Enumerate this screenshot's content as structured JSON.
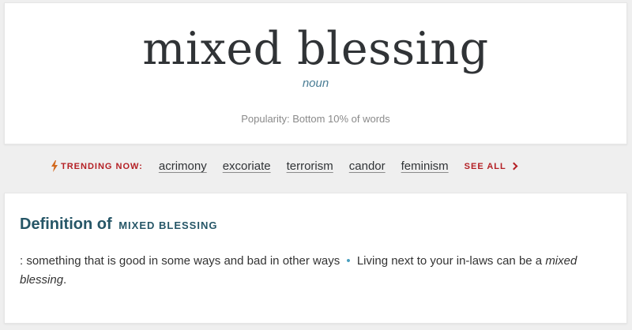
{
  "entry": {
    "headword": "mixed blessing",
    "part_of_speech": "noun",
    "popularity": "Popularity: Bottom 10% of words"
  },
  "trending": {
    "label": "TRENDING NOW:",
    "items": [
      "acrimony",
      "excoriate",
      "terrorism",
      "candor",
      "feminism"
    ],
    "see_all": "SEE ALL",
    "icon": "lightning-bolt-icon"
  },
  "definition": {
    "heading_prefix": "Definition of",
    "heading_word": "MIXED BLESSING",
    "text": ": something that is good in some ways and bad in other ways",
    "example_before": "Living next to your in-laws can be a",
    "example_italic": "mixed blessing",
    "example_after": "."
  },
  "colors": {
    "accent_red": "#b41f24",
    "heading_blue": "#265667",
    "pos_blue": "#4a7d95",
    "bullet_blue": "#4a9fbf"
  }
}
